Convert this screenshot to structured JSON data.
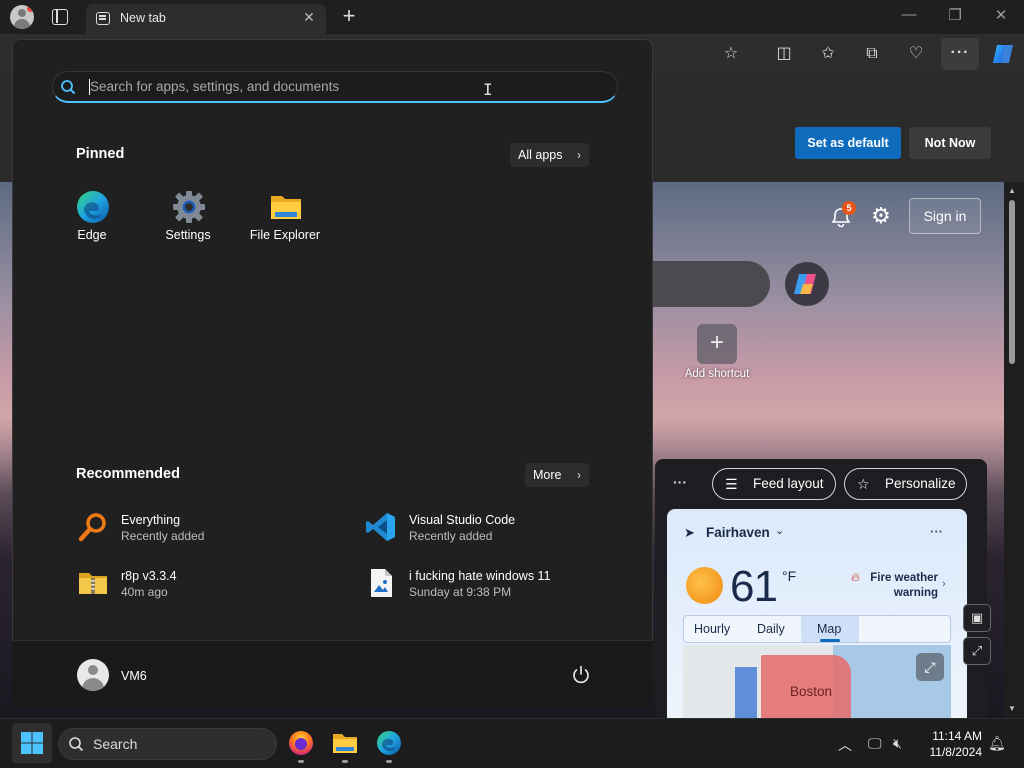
{
  "browser": {
    "tab_title": "New tab",
    "tab_close": "✕",
    "new_tab": "+",
    "window_controls": {
      "minimize": "—",
      "restore": "❐",
      "close": "✕"
    },
    "toolbar_more": "···"
  },
  "default_bar": {
    "set_default_label": "Set as default",
    "not_now_label": "Not Now"
  },
  "ntp": {
    "notification_count": "5",
    "sign_in_label": "Sign in",
    "add_shortcut_icon": "+",
    "add_shortcut_label": "Add shortcut",
    "feed_more": "···",
    "feed_layout_label": "Feed layout",
    "personalize_label": "Personalize"
  },
  "weather": {
    "location": "Fairhaven",
    "temperature": "61",
    "unit": "°F",
    "alert": "Fire weather warning",
    "tabs": [
      "Hourly",
      "Daily",
      "Map"
    ],
    "active_tab": "Map",
    "map_label": "Boston",
    "more": "···"
  },
  "start_menu": {
    "search_placeholder": "Search for apps, settings, and documents",
    "pinned_title": "Pinned",
    "all_apps_label": "All apps",
    "pinned": [
      {
        "label": "Edge",
        "icon": "edge-icon"
      },
      {
        "label": "Settings",
        "icon": "settings-icon"
      },
      {
        "label": "File Explorer",
        "icon": "file-explorer-icon"
      }
    ],
    "recommended_title": "Recommended",
    "more_label": "More",
    "recommended": [
      {
        "name": "Everything",
        "sub": "Recently added",
        "icon": "everything-icon"
      },
      {
        "name": "Visual Studio Code",
        "sub": "Recently added",
        "icon": "vscode-icon"
      },
      {
        "name": "r8p v3.3.4",
        "sub": "40m ago",
        "icon": "zip-folder-icon"
      },
      {
        "name": "i fucking hate windows 11",
        "sub": "Sunday at 9:38 PM",
        "icon": "image-file-icon"
      }
    ],
    "user_name": "VM6"
  },
  "taskbar": {
    "search_label": "Search",
    "time": "11:14 AM",
    "date": "11/8/2024"
  },
  "colors": {
    "accent": "#0f6cbd",
    "search_focus": "#4cc2ff",
    "badge": "#e8551a"
  }
}
